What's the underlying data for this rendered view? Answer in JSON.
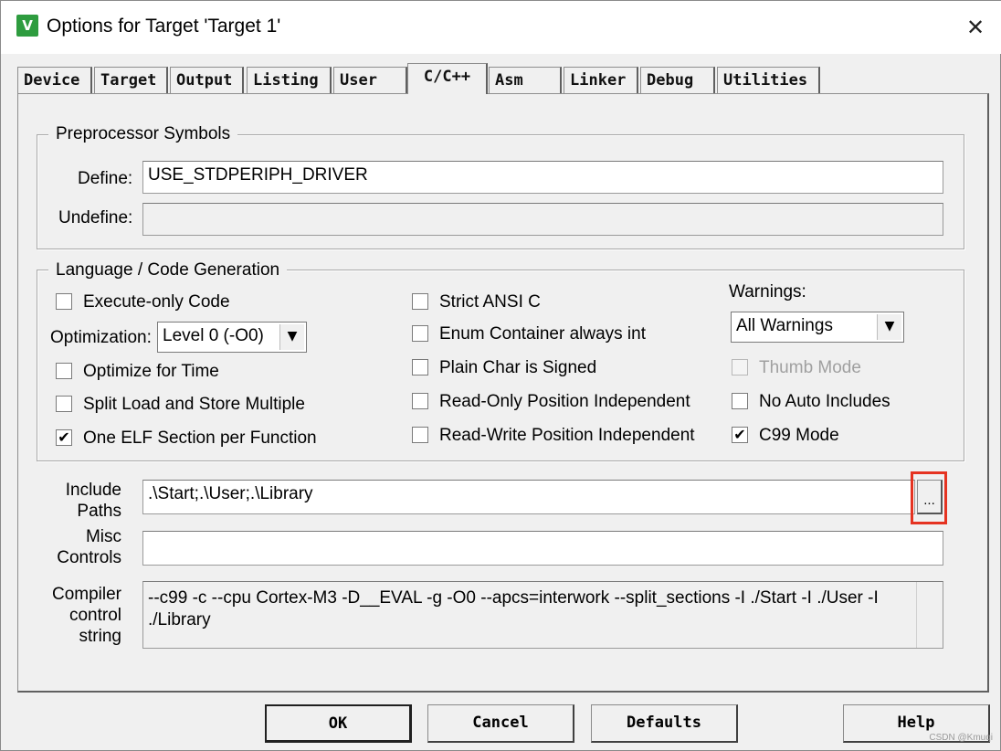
{
  "window": {
    "title": "Options for Target 'Target 1'",
    "icon_text": "V",
    "close_symbol": "✕"
  },
  "tabs": [
    {
      "label": "Device"
    },
    {
      "label": "Target"
    },
    {
      "label": "Output"
    },
    {
      "label": "Listing"
    },
    {
      "label": "User"
    },
    {
      "label": "C/C++",
      "active": true
    },
    {
      "label": "Asm"
    },
    {
      "label": "Linker"
    },
    {
      "label": "Debug"
    },
    {
      "label": "Utilities"
    }
  ],
  "preprocessor": {
    "group_label": "Preprocessor Symbols",
    "define_label": "Define:",
    "define_value": "USE_STDPERIPH_DRIVER",
    "undefine_label": "Undefine:",
    "undefine_value": ""
  },
  "language": {
    "group_label": "Language / Code Generation",
    "execute_only": {
      "label": "Execute-only Code",
      "checked": false
    },
    "optimization_label": "Optimization:",
    "optimization_value": "Level 0 (-O0)",
    "optimize_time": {
      "label": "Optimize for Time",
      "checked": false
    },
    "split_load": {
      "label": "Split Load and Store Multiple",
      "checked": false
    },
    "one_elf": {
      "label": "One ELF Section per Function",
      "checked": true
    },
    "strict_ansi": {
      "label": "Strict ANSI C",
      "checked": false
    },
    "enum_container": {
      "label": "Enum Container always int",
      "checked": false
    },
    "plain_char": {
      "label": "Plain Char is Signed",
      "checked": false
    },
    "ro_pi": {
      "label": "Read-Only Position Independent",
      "checked": false
    },
    "rw_pi": {
      "label": "Read-Write Position Independent",
      "checked": false
    },
    "warnings_label": "Warnings:",
    "warnings_value": "All Warnings",
    "thumb_mode": {
      "label": "Thumb Mode",
      "checked": false,
      "disabled": true
    },
    "no_auto_includes": {
      "label": "No Auto Includes",
      "checked": false
    },
    "c99_mode": {
      "label": "C99 Mode",
      "checked": true
    }
  },
  "include_paths": {
    "label_line1": "Include",
    "label_line2": "Paths",
    "value": ".\\Start;.\\User;.\\Library",
    "browse_label": "..."
  },
  "misc_controls": {
    "label_line1": "Misc",
    "label_line2": "Controls",
    "value": ""
  },
  "compiler_control": {
    "label_line1": "Compiler",
    "label_line2": "control",
    "label_line3": "string",
    "value": "--c99 -c --cpu Cortex-M3 -D__EVAL -g -O0 --apcs=interwork --split_sections -I ./Start -I ./User -I ./Library"
  },
  "buttons": {
    "ok": "OK",
    "cancel": "Cancel",
    "defaults": "Defaults",
    "help": "Help"
  },
  "watermark": "CSDN @Kmuqi",
  "colors": {
    "highlight": "#e53321",
    "app_icon": "#2e9c3f"
  }
}
